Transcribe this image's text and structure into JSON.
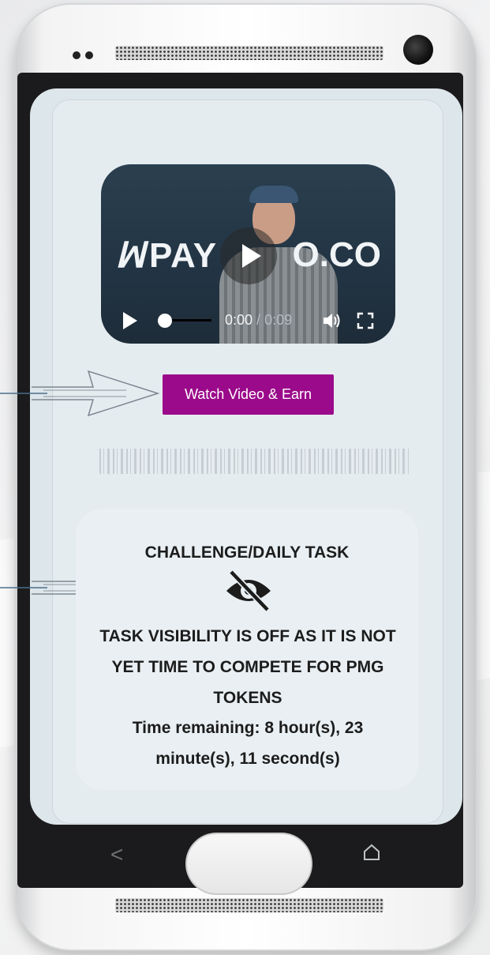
{
  "video": {
    "brand_left": "PAY",
    "brand_right": "O.CO",
    "time_current": "0:00",
    "time_separator": " / ",
    "time_duration": "0:09",
    "progress": 0.0
  },
  "actions": {
    "watch_button_label": "Watch Video & Earn"
  },
  "task": {
    "heading": "CHALLENGE/DAILY TASK",
    "message": "TASK VISIBILITY IS OFF AS IT IS NOT YET TIME TO COMPETE FOR PMG TOKENS",
    "time_remaining": "Time remaining: 8 hour(s), 23 minute(s), 11 second(s)"
  },
  "navbar": {
    "back_glyph": "<"
  },
  "icons": {
    "big_play": "play-icon",
    "control_play": "play-icon",
    "volume": "volume-icon",
    "fullscreen": "fullscreen-icon",
    "visibility_off": "eye-slash-icon",
    "home": "home-icon",
    "back": "back-icon"
  },
  "colors": {
    "accent_button": "#9b0a8a",
    "video_bg": "#223444",
    "screen_bg": "#dde6ea"
  }
}
